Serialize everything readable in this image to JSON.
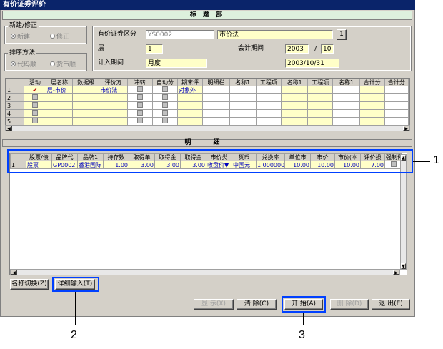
{
  "window": {
    "title": "有价证券评价"
  },
  "header_band": {
    "label": "标 题 部"
  },
  "mode_group": {
    "title": "新建/修正",
    "opt_new": "新建",
    "opt_edit": "修正"
  },
  "sort_group": {
    "title": "排序方法",
    "opt_code": "代码顺",
    "opt_currency": "货币顺"
  },
  "form": {
    "category_label": "有价证券区分",
    "category_code": "YS0002",
    "category_name": "市价法",
    "lookup_label": "1",
    "layer_label": "层",
    "layer_value": "1",
    "period_label": "会计期间",
    "year_value": "2003",
    "slash": "/",
    "month_value": "10",
    "charge_label": "计入期间",
    "charge_value": "月度",
    "date_value": "2003/10/31"
  },
  "upper_grid": {
    "headers": [
      "",
      "活动",
      "层名称",
      "数据级",
      "评价方",
      "冲转",
      "自动分",
      "期末评",
      "明细栏",
      "名称1",
      "工程项",
      "名称1",
      "工程项",
      "名称1",
      "合计分",
      "合计分"
    ],
    "rows": [
      [
        "1",
        "✔",
        "层-市价",
        "",
        "市价法",
        "",
        "",
        "对象外",
        "",
        "",
        "",
        "",
        "",
        "",
        "",
        ""
      ],
      [
        "2",
        "",
        "",
        "",
        "",
        "",
        "",
        "",
        "",
        "",
        "",
        "",
        "",
        "",
        "",
        ""
      ],
      [
        "3",
        "",
        "",
        "",
        "",
        "",
        "",
        "",
        "",
        "",
        "",
        "",
        "",
        "",
        "",
        ""
      ],
      [
        "4",
        "",
        "",
        "",
        "",
        "",
        "",
        "",
        "",
        "",
        "",
        "",
        "",
        "",
        "",
        ""
      ],
      [
        "5",
        "",
        "",
        "",
        "",
        "",
        "",
        "",
        "",
        "",
        "",
        "",
        "",
        "",
        "",
        ""
      ]
    ]
  },
  "detail_band": {
    "label": "明 细"
  },
  "detail_grid": {
    "headers": [
      "",
      "股票/债",
      "品牌代",
      "品牌1",
      "持存数",
      "取得单",
      "取得金",
      "取得金",
      "市价类",
      "货币",
      "兑换率",
      "单位市",
      "市价",
      "市价(本",
      "评价损",
      "强制评"
    ],
    "rows": [
      [
        "1",
        "股票",
        "GP0002",
        "香港国际",
        "1.00",
        "3.00",
        "3.00",
        "3.00",
        "收盘价▼",
        "中国元",
        "1.000000",
        "10.00",
        "10.00",
        "10.00",
        "7.00",
        ""
      ]
    ]
  },
  "buttons": {
    "name_switch": "名称切换(Z)",
    "detail_input": "详细输入(T)",
    "display": "显 示(X)",
    "clear": "清 除(C)",
    "start": "开 始(A)",
    "delete": "删 除(D)",
    "exit": "退 出(E)"
  },
  "callouts": {
    "c1": "1",
    "c2": "2",
    "c3": "3"
  },
  "colors": {
    "title_bar": "#0a246a",
    "callout": "#0040ff",
    "header_band": "#ddf0dd",
    "field_yellow": "#ffffc8"
  }
}
